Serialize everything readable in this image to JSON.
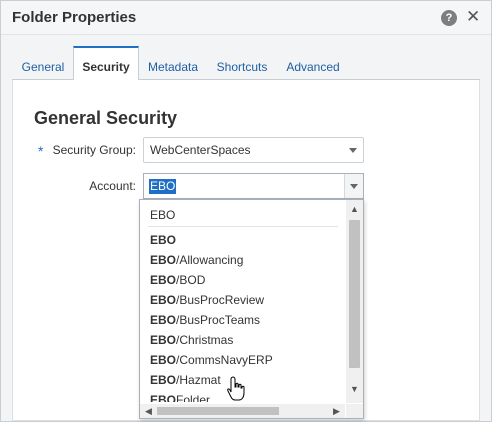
{
  "dialog": {
    "title": "Folder Properties",
    "help_icon": "help-icon",
    "help_glyph": "?",
    "close_icon": "close-icon",
    "close_glyph": "✕"
  },
  "tabs": [
    {
      "label": "General",
      "active": false
    },
    {
      "label": "Security",
      "active": true
    },
    {
      "label": "Metadata",
      "active": false
    },
    {
      "label": "Shortcuts",
      "active": false
    },
    {
      "label": "Advanced",
      "active": false
    }
  ],
  "section": {
    "title": "General Security",
    "required_marker": "*"
  },
  "security_group": {
    "label": "Security Group:",
    "value": "WebCenterSpaces"
  },
  "account": {
    "label": "Account:",
    "value": "EBO"
  },
  "dropdown": {
    "filter_text": "EBO",
    "items": [
      {
        "bold": "EBO",
        "rest": ""
      },
      {
        "bold": "EBO",
        "rest": "/Allowancing"
      },
      {
        "bold": "EBO",
        "rest": "/BOD"
      },
      {
        "bold": "EBO",
        "rest": "/BusProcReview"
      },
      {
        "bold": "EBO",
        "rest": "/BusProcTeams"
      },
      {
        "bold": "EBO",
        "rest": "/Christmas"
      },
      {
        "bold": "EBO",
        "rest": "/CommsNavyERP"
      },
      {
        "bold": "EBO",
        "rest": "/Hazmat"
      },
      {
        "bold": "EBO",
        "rest": "Folder"
      }
    ]
  },
  "colors": {
    "accent": "#1f6fc4",
    "tab_link": "#1f5fa3",
    "selection": "#1f6fc4"
  }
}
